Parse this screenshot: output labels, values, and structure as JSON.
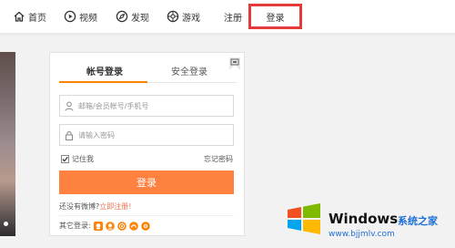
{
  "nav": {
    "items": [
      {
        "label": "首页",
        "icon": "home-icon"
      },
      {
        "label": "视频",
        "icon": "video-icon"
      },
      {
        "label": "发现",
        "icon": "discover-icon"
      },
      {
        "label": "游戏",
        "icon": "game-icon"
      }
    ],
    "register_label": "注册",
    "login_label": "登录",
    "highlight_color": "#e53a37"
  },
  "login": {
    "tabs": [
      "帐号登录",
      "安全登录"
    ],
    "username_placeholder": "邮箱/会员帐号/手机号",
    "password_placeholder": "请输入密码",
    "remember_label": "记住我",
    "remember_checked": true,
    "forgot_label": "忘记密码",
    "submit_label": "登录",
    "no_account_text": "还没有微博?",
    "register_now_label": "立即注册!",
    "other_login_label": "其它登录:",
    "social_icons": [
      "qq-icon",
      "taobao-icon",
      "wechat-icon",
      "douban-icon",
      "sina-icon"
    ],
    "accent_color": "#ff8200",
    "button_color": "#ff8140"
  },
  "watermark": {
    "title": "Windows",
    "subtitle": "系统之家",
    "url": "www.bjjmlv.com"
  }
}
